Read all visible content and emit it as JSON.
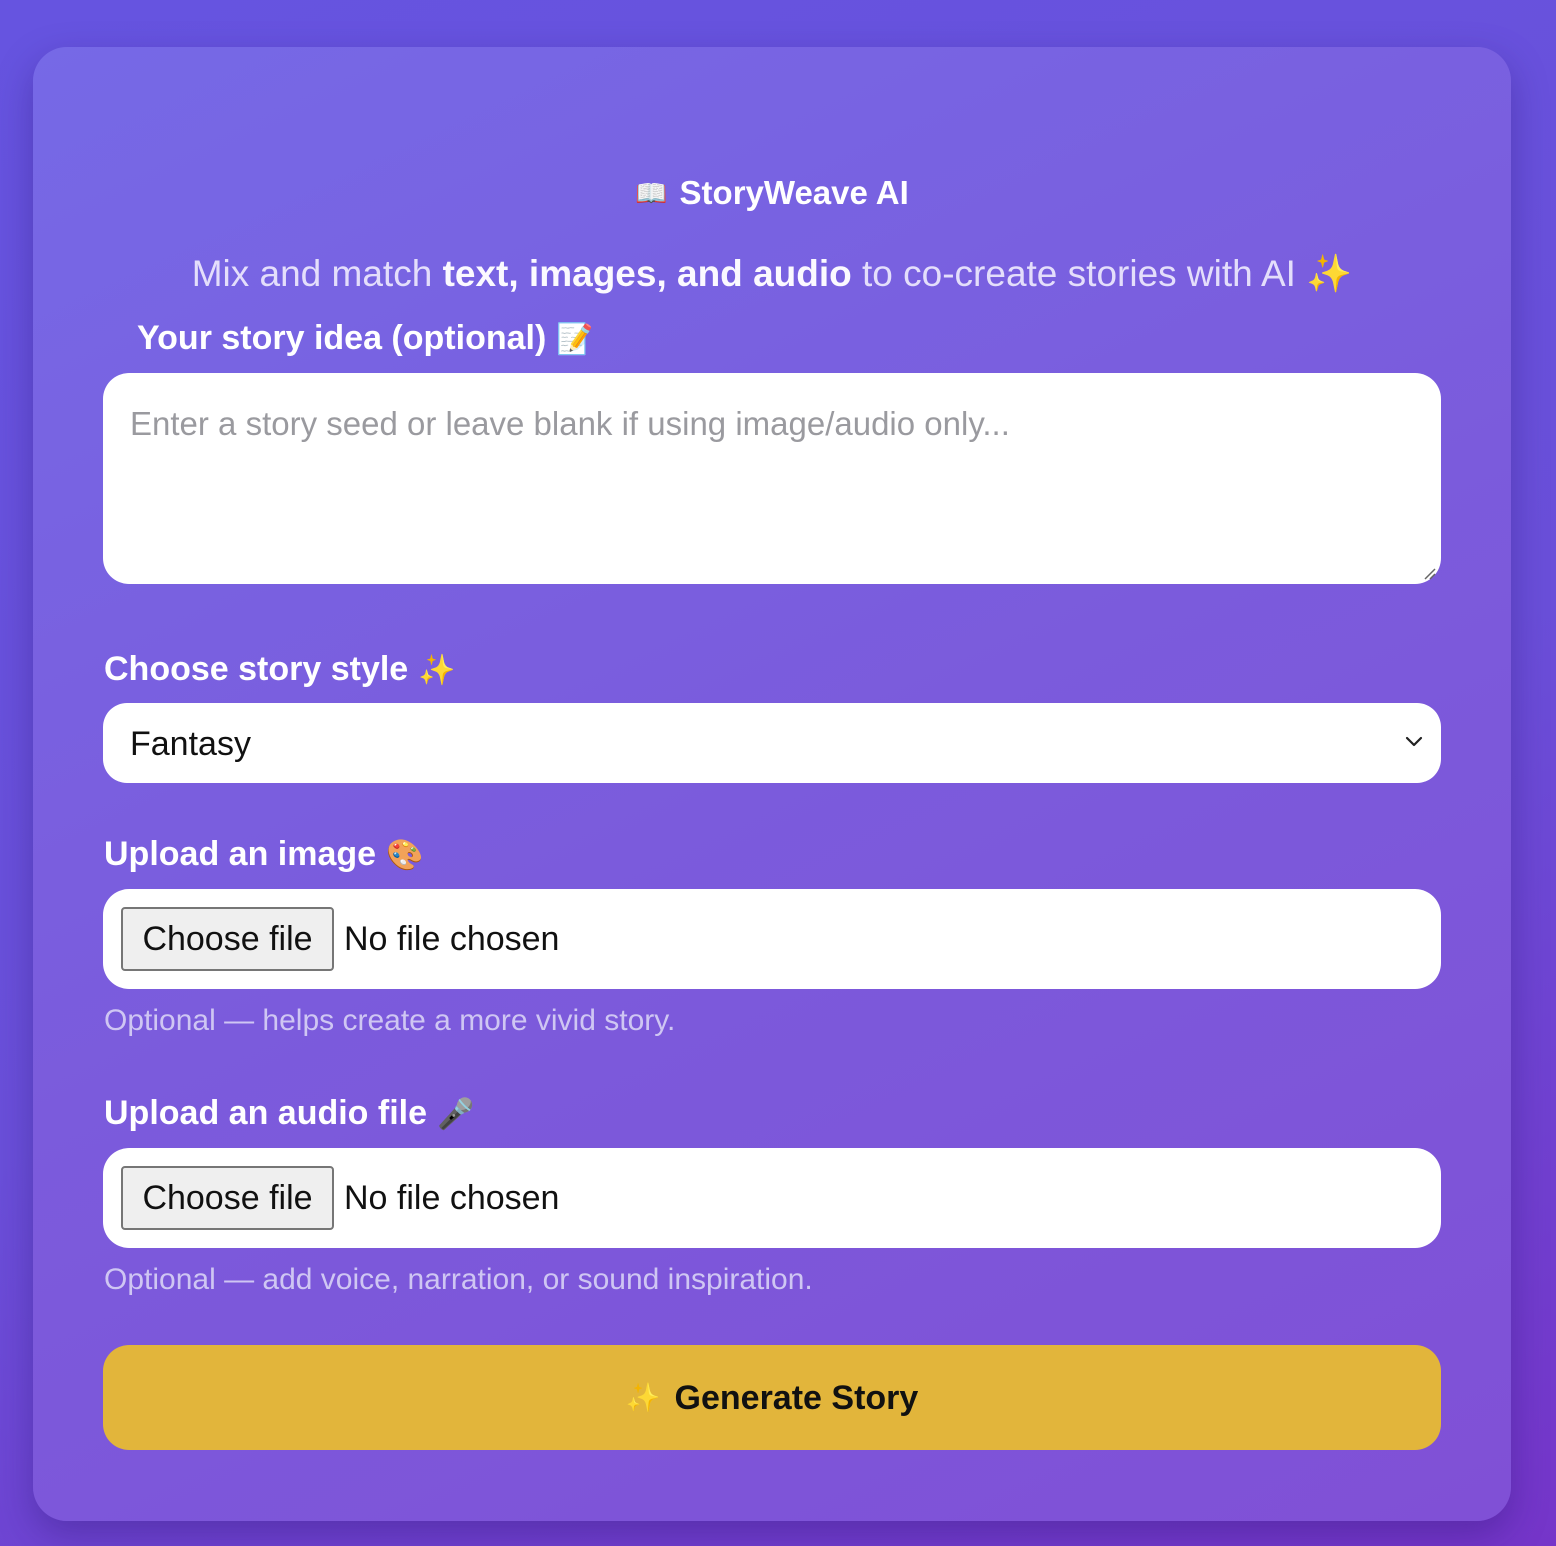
{
  "header": {
    "title_icon": "📖",
    "title": "StoryWeave AI",
    "subtitle_prefix": "Mix and match ",
    "subtitle_bold": "text, images, and audio",
    "subtitle_suffix": " to co-create stories with AI",
    "subtitle_icon": "✨"
  },
  "story_idea": {
    "label": "Your story idea (optional)",
    "label_icon": "📝",
    "value": "",
    "placeholder": "Enter a story seed or leave blank if using image/audio only..."
  },
  "story_style": {
    "label": "Choose story style",
    "label_icon": "✨",
    "selected": "Fantasy"
  },
  "image_upload": {
    "label": "Upload an image",
    "label_icon": "🎨",
    "button_label": "Choose file",
    "status": "No file chosen",
    "hint": "Optional — helps create a more vivid story."
  },
  "audio_upload": {
    "label": "Upload an audio file",
    "label_icon": "🎤",
    "button_label": "Choose file",
    "status": "No file chosen",
    "hint": "Optional — add voice, narration, or sound inspiration."
  },
  "generate": {
    "icon": "✨",
    "label": "Generate Story"
  },
  "colors": {
    "accent_button": "#e2b53b",
    "background_start": "#6654e0",
    "background_end": "#7535c9",
    "hint_text": "#cfc6f3"
  }
}
